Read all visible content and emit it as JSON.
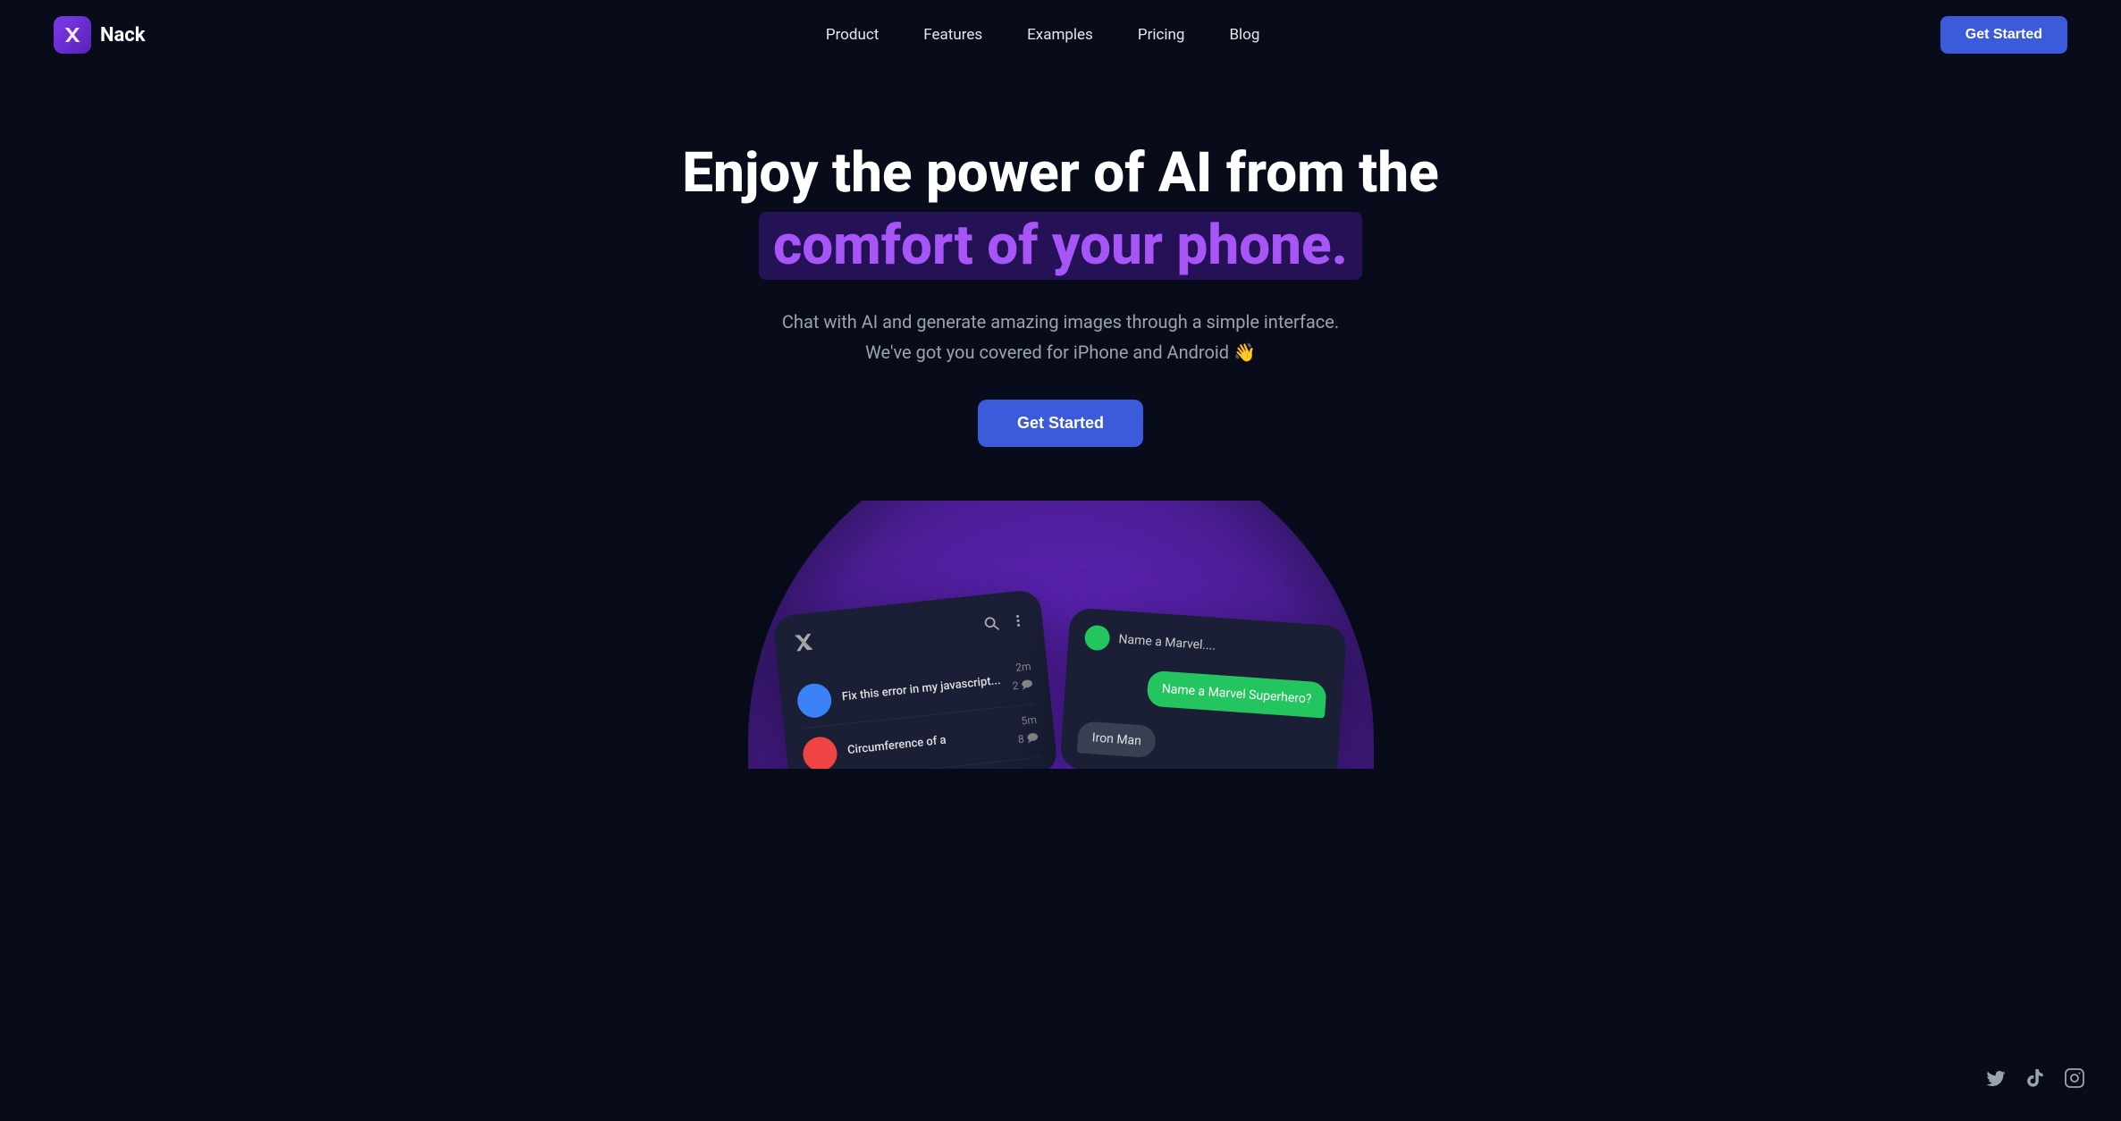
{
  "navbar": {
    "logo_label": "Nack",
    "nav_items": [
      {
        "label": "Product",
        "href": "#"
      },
      {
        "label": "Features",
        "href": "#"
      },
      {
        "label": "Examples",
        "href": "#"
      },
      {
        "label": "Pricing",
        "href": "#"
      },
      {
        "label": "Blog",
        "href": "#"
      }
    ],
    "cta_label": "Get Started"
  },
  "hero": {
    "title_line1": "Enjoy the power of AI from the",
    "title_line2": "comfort of your phone.",
    "subtitle_line1": "Chat with AI and generate amazing images through a simple interface.",
    "subtitle_line2": "We've got you covered for iPhone and Android 👋",
    "cta_label": "Get Started"
  },
  "phone_left": {
    "chat_items": [
      {
        "text": "Fix this error in my javascript...",
        "time": "2m",
        "count": "2 🗩",
        "avatar_color": "blue"
      },
      {
        "text": "Circumference of a",
        "time": "5m",
        "count": "8 🗩",
        "avatar_color": "red"
      }
    ]
  },
  "phone_right": {
    "conv_title": "Name a Marvel....",
    "bubble_user": "Name a Marvel Superhero?",
    "bubble_response": "Iron Man"
  },
  "social": {
    "twitter_label": "Twitter",
    "tiktok_label": "TikTok",
    "instagram_label": "Instagram"
  },
  "colors": {
    "bg": "#080c1a",
    "accent_purple": "#6d28d9",
    "accent_blue": "#3b5bdb",
    "highlight_text": "#a855f7",
    "highlight_bg": "rgba(88, 28, 200, 0.35)"
  }
}
